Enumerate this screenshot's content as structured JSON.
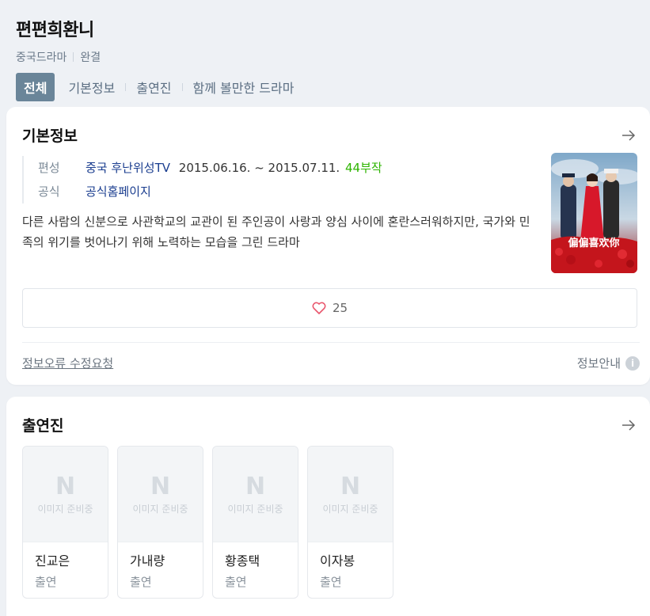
{
  "header": {
    "title": "편편희환니",
    "genre": "중국드라마",
    "status": "완결",
    "tabs": [
      "전체",
      "기본정보",
      "출연진",
      "함께 볼만한 드라마"
    ]
  },
  "basic_info": {
    "section_title": "기본정보",
    "broadcast_label": "편성",
    "broadcast_channel": "중국 후난위성TV",
    "broadcast_period": "2015.06.16. ~ 2015.07.11.",
    "episodes": "44부작",
    "official_label": "공식",
    "official_link": "공식홈페이지",
    "description": "다른 사람의 신분으로 사관학교의 교관이 된 주인공이 사랑과 양심 사이에 혼란스러워하지만, 국가와 민족의 위기를 벗어나기 위해 노력하는 모습을 그린 드라마",
    "like_count": "25",
    "report_link": "정보오류 수정요청",
    "guide_label": "정보안내",
    "guide_icon": "i",
    "poster_text": "偏偏喜欢你"
  },
  "cast": {
    "section_title": "출연진",
    "placeholder_logo": "N",
    "placeholder_text": "이미지 준비중",
    "members": [
      {
        "name": "진교은",
        "role": "출연"
      },
      {
        "name": "가내량",
        "role": "출연"
      },
      {
        "name": "황종택",
        "role": "출연"
      },
      {
        "name": "이자봉",
        "role": "출연"
      }
    ]
  },
  "colors": {
    "accent_tab": "#6a8599",
    "link": "#1a3d8f",
    "episodes_green": "#2db400",
    "heart": "#e9546b"
  }
}
